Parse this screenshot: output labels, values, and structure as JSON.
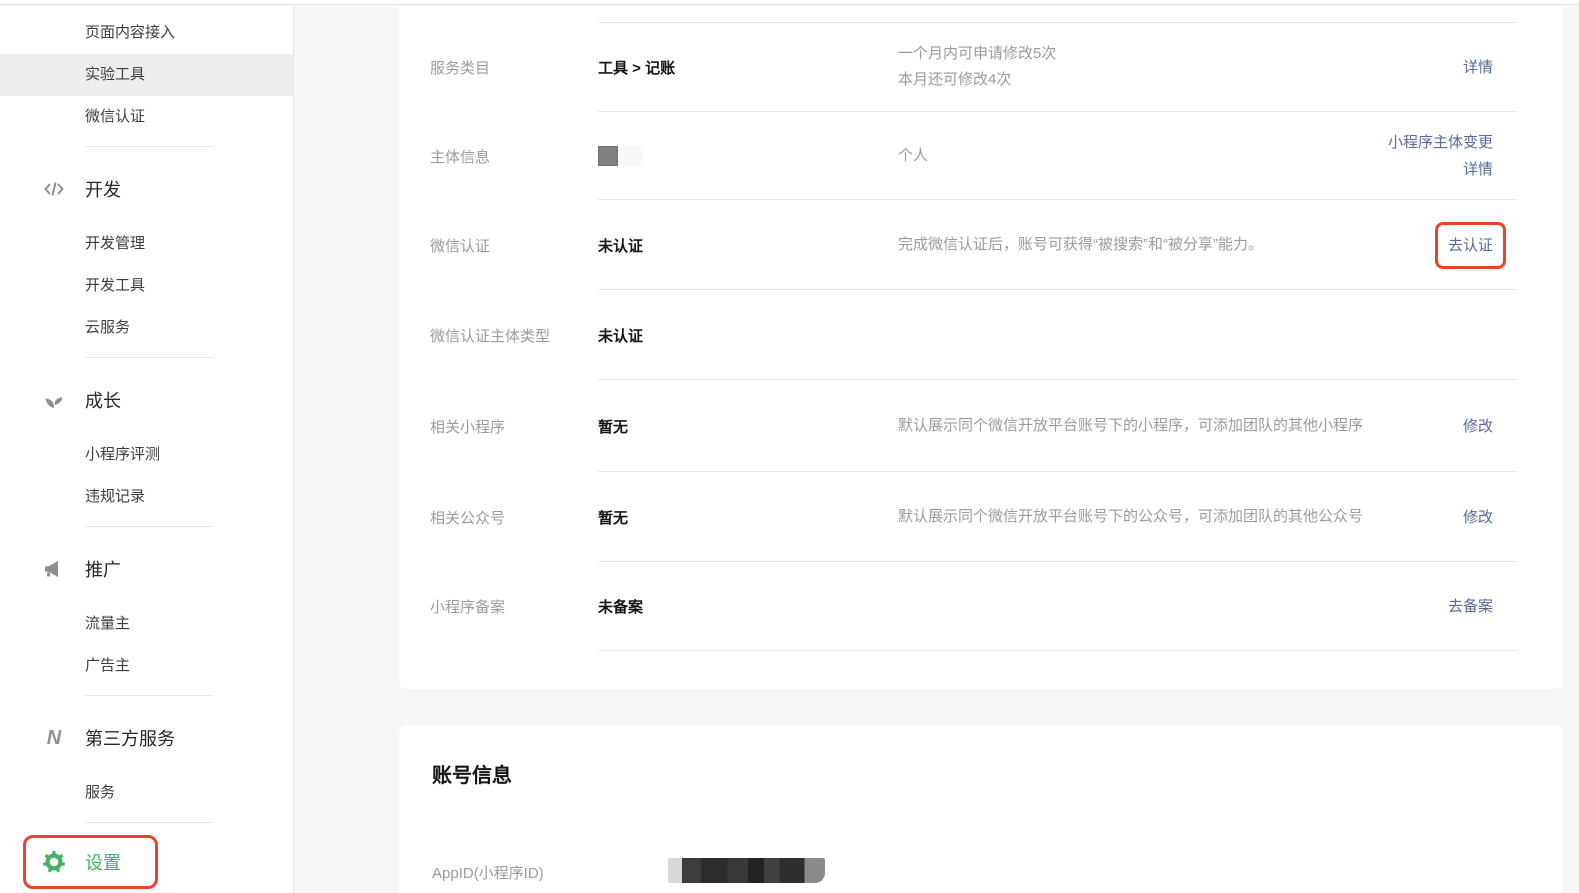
{
  "colors": {
    "link_blue": "#576b95",
    "wechat_green": "#45b264",
    "annotation_red": "#e8432d",
    "active_item_bg": "#ededee",
    "page_bg": "#f6f7f9"
  },
  "sidebar": {
    "top_items": [
      "页面内容接入",
      "实验工具",
      "微信认证"
    ],
    "active_item": "实验工具",
    "sections": [
      {
        "label": "开发",
        "icon": "code-icon",
        "items": [
          "开发管理",
          "开发工具",
          "云服务"
        ]
      },
      {
        "label": "成长",
        "icon": "sprout-icon",
        "items": [
          "小程序评测",
          "违规记录"
        ]
      },
      {
        "label": "推广",
        "icon": "megaphone-icon",
        "items": [
          "流量主",
          "广告主"
        ]
      },
      {
        "label": "第三方服务",
        "icon": "third-party-icon",
        "items": [
          "服务"
        ]
      },
      {
        "label": "设置",
        "icon": "gear-icon",
        "items": [],
        "highlighted": true
      }
    ]
  },
  "settings": {
    "rows": [
      {
        "label": "服务类目",
        "value": "工具 > 记账",
        "desc_lines": [
          "一个月内可申请修改5次",
          "本月还可修改4次"
        ],
        "actions": [
          "详情"
        ]
      },
      {
        "label": "主体信息",
        "value": "",
        "redacted": true,
        "desc": "个人",
        "actions": [
          "小程序主体变更",
          "详情"
        ]
      },
      {
        "label": "微信认证",
        "value": "未认证",
        "desc": "完成微信认证后，账号可获得“被搜索”和“被分享”能力。",
        "actions": [
          "去认证"
        ],
        "action_boxed": true
      },
      {
        "label": "微信认证主体类型",
        "value": "未认证"
      },
      {
        "label": "相关小程序",
        "value": "暂无",
        "desc": "默认展示同个微信开放平台账号下的小程序，可添加团队的其他小程序",
        "actions": [
          "修改"
        ]
      },
      {
        "label": "相关公众号",
        "value": "暂无",
        "desc": "默认展示同个微信开放平台账号下的公众号，可添加团队的其他公众号",
        "actions": [
          "修改"
        ]
      },
      {
        "label": "小程序备案",
        "value": "未备案",
        "actions": [
          "去备案"
        ]
      }
    ]
  },
  "account_card": {
    "title": "账号信息",
    "appid_label": "AppID(小程序ID)",
    "appid_value_redacted": true
  }
}
